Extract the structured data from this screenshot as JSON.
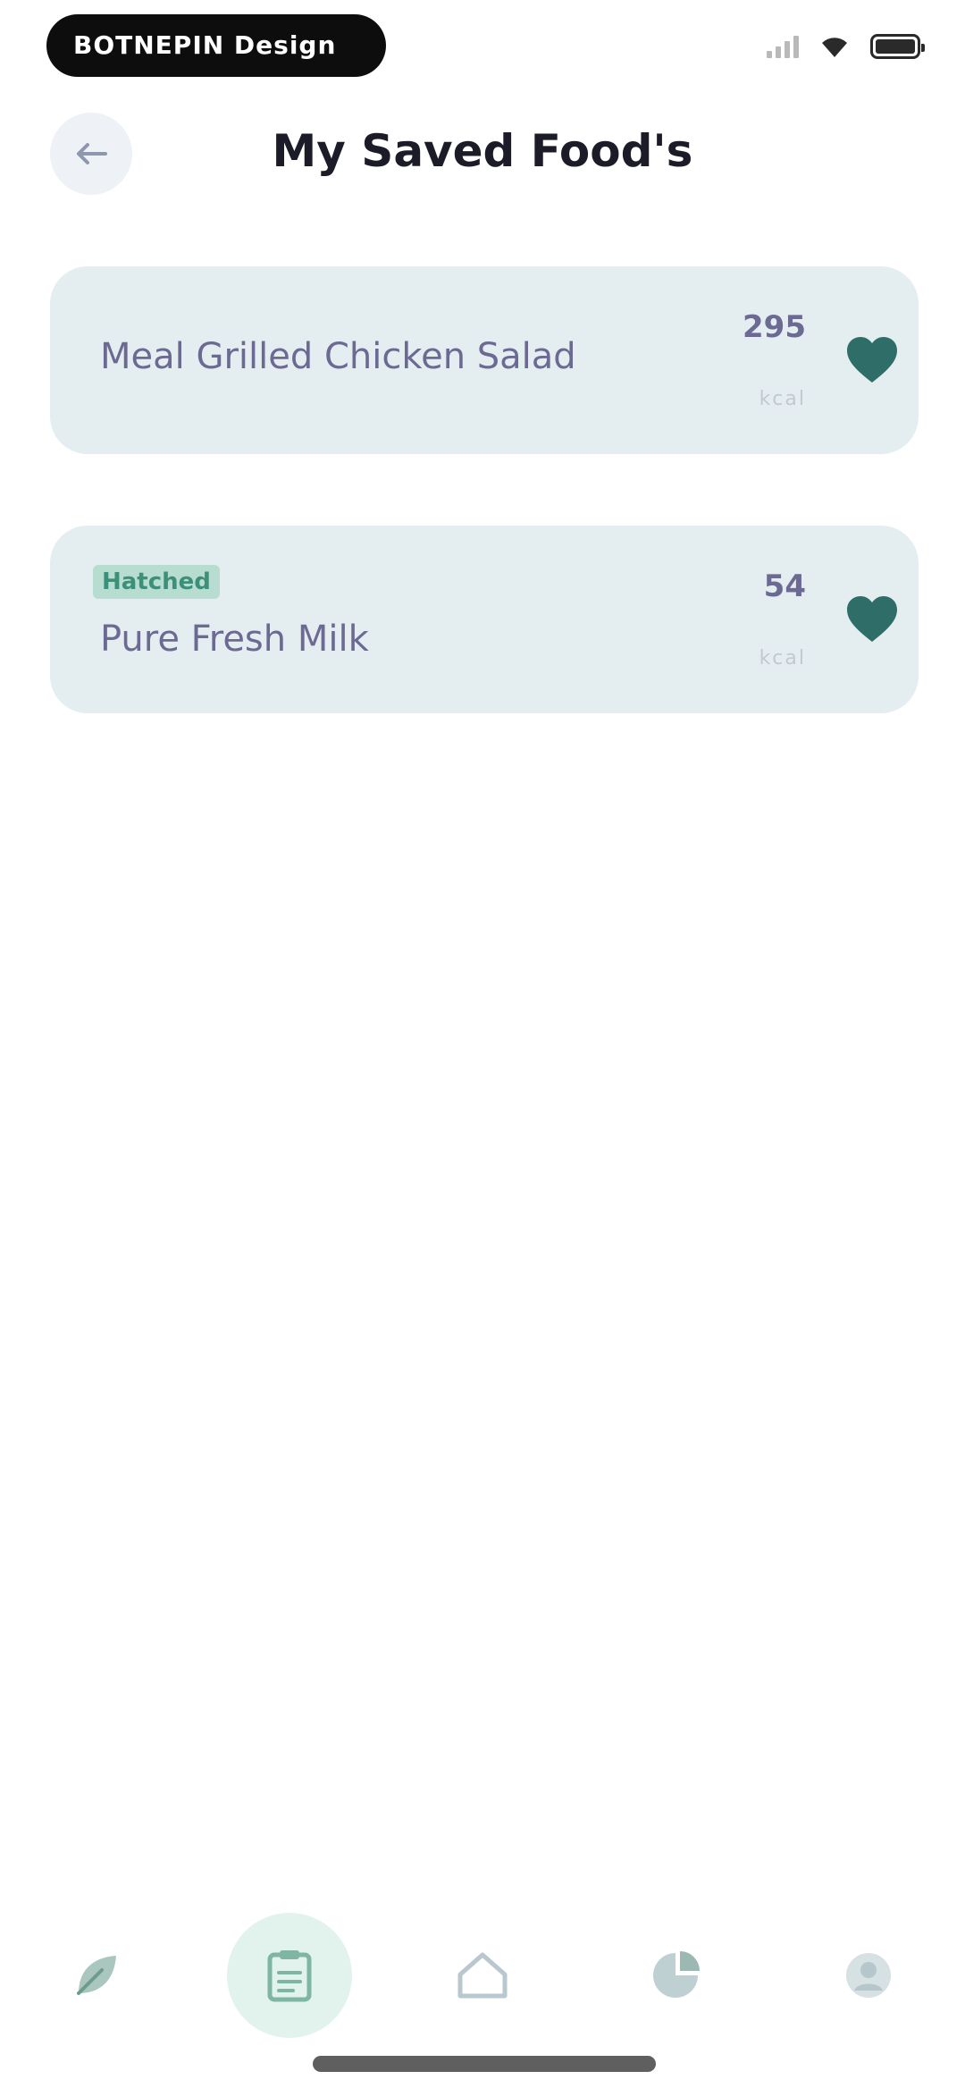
{
  "status_bar": {
    "pill_text": "BOTNEPIN Design",
    "icons": [
      "signal-icon",
      "wifi-icon",
      "battery-icon"
    ]
  },
  "header": {
    "back_icon": "arrow-left-icon",
    "title": "My Saved Food's"
  },
  "saved_foods": [
    {
      "tag": "",
      "name": "Meal Grilled Chicken Salad",
      "calories": "295",
      "unit": "kcal",
      "icon": "heart-icon"
    },
    {
      "tag": "Hatched",
      "name": "Pure Fresh Milk",
      "calories": "54",
      "unit": "kcal",
      "icon": "heart-icon"
    }
  ],
  "bottom_nav": {
    "items": [
      {
        "icon": "leaf-icon"
      },
      {
        "icon": "clipboard-icon",
        "active": true
      },
      {
        "icon": "home-icon"
      },
      {
        "icon": "chart-icon"
      },
      {
        "icon": "profile-icon"
      }
    ]
  },
  "colors": {
    "accent": "#2f6e68",
    "card_bg": "#e4eef1",
    "nav_active_bg": "#e2f2ec",
    "title": "#1c1c28",
    "food_text": "#6c6a93"
  }
}
